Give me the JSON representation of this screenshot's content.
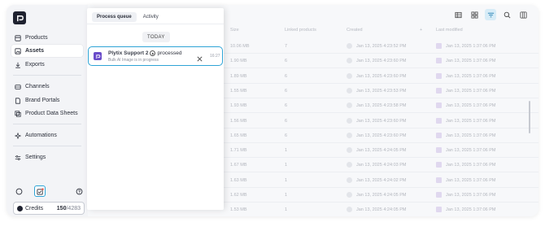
{
  "sidebar": {
    "items": [
      {
        "label": "Products",
        "icon": "products-icon",
        "active": false
      },
      {
        "label": "Assets",
        "icon": "image-icon",
        "active": true
      },
      {
        "label": "Exports",
        "icon": "download-icon",
        "active": false
      },
      {
        "label": "Channels",
        "icon": "channels-icon",
        "active": false
      },
      {
        "label": "Brand Portals",
        "icon": "document-icon",
        "active": false
      },
      {
        "label": "Product Data Sheets",
        "icon": "layers-icon",
        "active": false
      },
      {
        "label": "Automations",
        "icon": "sparkle-icon",
        "active": false
      },
      {
        "label": "Settings",
        "icon": "sliders-icon",
        "active": false
      }
    ],
    "credits": {
      "label": "Credits",
      "used": "150",
      "separator": "/",
      "total": "4283"
    }
  },
  "panel": {
    "tabs": [
      "Process queue",
      "Activity"
    ],
    "active_tab": "Process queue",
    "day_label": "TODAY",
    "notification": {
      "user": "Plytix Support 2",
      "action": "processed",
      "subtitle": "Bulk AI Image is in progress",
      "time": "16:27"
    }
  },
  "table": {
    "headers": [
      "Size",
      "Linked products",
      "Created",
      "+",
      "Last modified"
    ],
    "rows": [
      {
        "size": "10.06 MB",
        "linked": "7",
        "created": "Jan 13, 2025 4:23:52 PM",
        "modified": "Jan 13, 2025 1:37:06 PM"
      },
      {
        "size": "1.90 MB",
        "linked": "6",
        "created": "Jan 13, 2025 4:23:60 PM",
        "modified": "Jan 13, 2025 1:37:06 PM"
      },
      {
        "size": "1.89 MB",
        "linked": "6",
        "created": "Jan 13, 2025 4:23:60 PM",
        "modified": "Jan 13, 2025 1:37:06 PM"
      },
      {
        "size": "1.55 MB",
        "linked": "6",
        "created": "Jan 13, 2025 4:23:53 PM",
        "modified": "Jan 13, 2025 1:37:06 PM"
      },
      {
        "size": "1.93 MB",
        "linked": "6",
        "created": "Jan 13, 2025 4:23:58 PM",
        "modified": "Jan 13, 2025 1:37:06 PM"
      },
      {
        "size": "1.56 MB",
        "linked": "6",
        "created": "Jan 13, 2025 4:23:60 PM",
        "modified": "Jan 13, 2025 1:37:06 PM"
      },
      {
        "size": "1.65 MB",
        "linked": "6",
        "created": "Jan 13, 2025 4:23:60 PM",
        "modified": "Jan 13, 2025 1:37:06 PM"
      },
      {
        "size": "1.71 MB",
        "linked": "1",
        "created": "Jan 13, 2025 4:24:05 PM",
        "modified": "Jan 13, 2025 1:37:06 PM"
      },
      {
        "size": "1.67 MB",
        "linked": "1",
        "created": "Jan 13, 2025 4:24:03 PM",
        "modified": "Jan 13, 2025 1:37:06 PM"
      },
      {
        "size": "1.63 MB",
        "linked": "1",
        "created": "Jan 13, 2025 4:24:02 PM",
        "modified": "Jan 13, 2025 1:37:06 PM"
      },
      {
        "size": "1.62 MB",
        "linked": "1",
        "created": "Jan 13, 2025 4:24:05 PM",
        "modified": "Jan 13, 2025 1:37:06 PM"
      },
      {
        "size": "1.53 MB",
        "linked": "1",
        "created": "Jan 13, 2025 4:24:05 PM",
        "modified": "Jan 13, 2025 1:37:06 PM"
      }
    ]
  },
  "colors": {
    "accent": "#2fa4d6",
    "brand_dark": "#1f2230",
    "notif_icon": "#6a4cc9"
  }
}
